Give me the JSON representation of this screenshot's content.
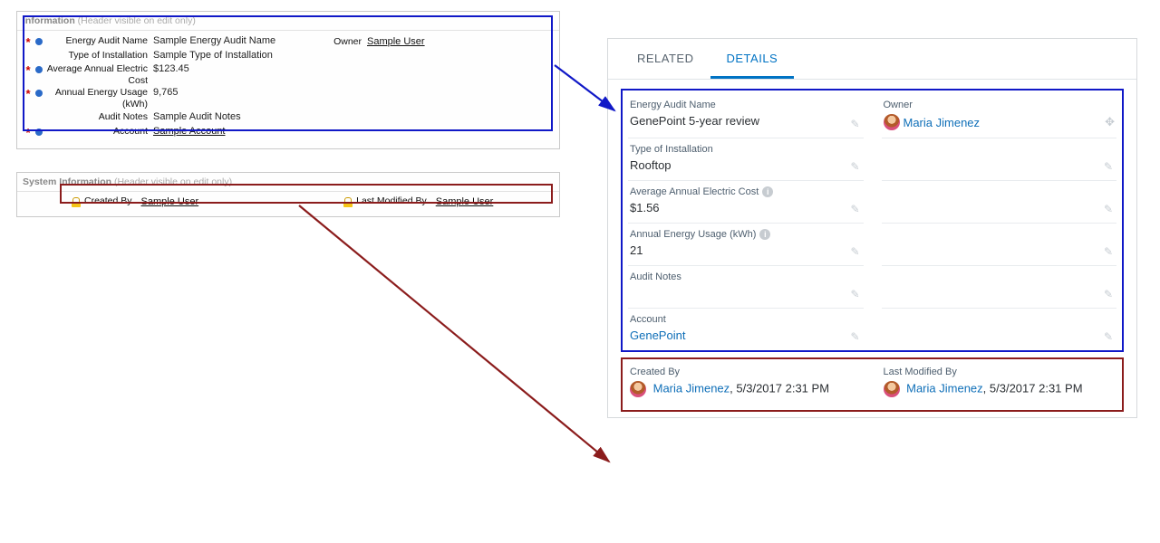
{
  "classic": {
    "information": {
      "title": "Information",
      "sub": "(Header visible on edit only)",
      "fields": [
        {
          "label": "Energy Audit Name",
          "value": "Sample Energy Audit Name",
          "required": true,
          "dot": true,
          "link": false
        },
        {
          "label": "Type of Installation",
          "value": "Sample Type of Installation",
          "required": false,
          "dot": false,
          "link": false
        },
        {
          "label": "Average Annual Electric Cost",
          "value": "$123.45",
          "required": true,
          "dot": true,
          "link": false
        },
        {
          "label": "Annual Energy Usage (kWh)",
          "value": "9,765",
          "required": true,
          "dot": true,
          "link": false
        },
        {
          "label": "Audit Notes",
          "value": "Sample Audit Notes",
          "required": false,
          "dot": false,
          "link": false
        },
        {
          "label": "Account",
          "value": "Sample Account",
          "required": true,
          "dot": true,
          "link": true
        }
      ],
      "owner": {
        "label": "Owner",
        "value": "Sample User"
      }
    },
    "system": {
      "title": "System Information",
      "sub": "(Header visible on edit only)",
      "createdBy": {
        "label": "Created By",
        "value": "Sample User"
      },
      "modifiedBy": {
        "label": "Last Modified By",
        "value": "Sample User"
      }
    }
  },
  "lightning": {
    "tabs": {
      "related": "RELATED",
      "details": "DETAILS"
    },
    "details": {
      "energyAuditName": {
        "label": "Energy Audit Name",
        "value": "GenePoint 5-year review"
      },
      "owner": {
        "label": "Owner",
        "value": "Maria Jimenez"
      },
      "typeInstall": {
        "label": "Type of Installation",
        "value": "Rooftop"
      },
      "avgCost": {
        "label": "Average Annual Electric Cost",
        "value": "$1.56"
      },
      "usage": {
        "label": "Annual Energy Usage (kWh)",
        "value": "21"
      },
      "auditNotes": {
        "label": "Audit Notes",
        "value": ""
      },
      "account": {
        "label": "Account",
        "value": "GenePoint"
      }
    },
    "system": {
      "createdBy": {
        "label": "Created By",
        "user": "Maria Jimenez",
        "ts": "5/3/2017 2:31 PM"
      },
      "modifiedBy": {
        "label": "Last Modified By",
        "user": "Maria Jimenez",
        "ts": "5/3/2017 2:31 PM"
      }
    }
  }
}
